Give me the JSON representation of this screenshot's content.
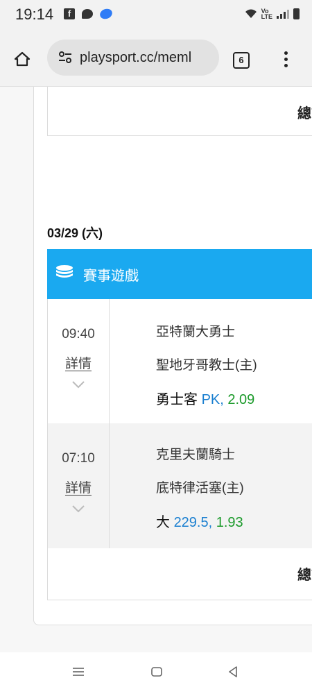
{
  "status_bar": {
    "time": "19:14",
    "lte": "Vo\nLTE",
    "icons": [
      "facebook-icon",
      "chat-icon",
      "app-icon",
      "wifi-icon",
      "signal-icon",
      "battery-icon"
    ]
  },
  "browser": {
    "url": "playsport.cc/meml",
    "tab_count": "6"
  },
  "page": {
    "total_label_top": "總言",
    "date": "03/29 (六)",
    "section_header": "賽事遊戲",
    "games": [
      {
        "time": "09:40",
        "detail": "詳情",
        "away_team": "亞特蘭大勇士",
        "home_team": "聖地牙哥教士(主)",
        "pick_prefix": "勇士客",
        "pick_line": "PK,",
        "pick_odds": "2.09"
      },
      {
        "time": "07:10",
        "detail": "詳情",
        "away_team": "克里夫蘭騎士",
        "home_team": "底特律活塞(主)",
        "pick_prefix": "大",
        "pick_line": "229.5,",
        "pick_odds": "1.93"
      }
    ],
    "total_label_bottom": "總言"
  },
  "colors": {
    "header_blue": "#1aa9f0",
    "line_blue": "#1a7fd0",
    "odds_green": "#1b9a2a"
  }
}
